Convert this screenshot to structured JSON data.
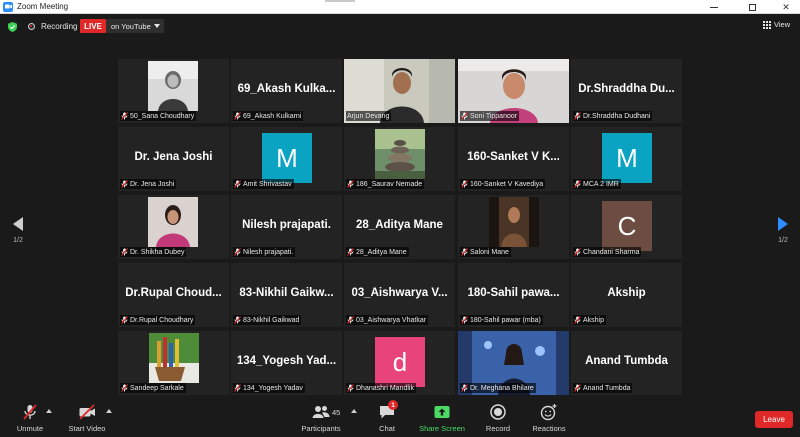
{
  "window": {
    "title": "Zoom Meeting"
  },
  "topbar": {
    "recording_label": "Recording",
    "live_label": "LIVE",
    "stream_target": "on YouTube",
    "view_label": "View"
  },
  "pagination": {
    "left": "1/2",
    "right": "1/2"
  },
  "tiles": [
    {
      "bigname": "",
      "label": "50_Sana Choudhary"
    },
    {
      "bigname": "69_Akash Kulka...",
      "label": "69_Akash Kulkarni"
    },
    {
      "bigname": "",
      "label": "Arjun Devang"
    },
    {
      "bigname": "",
      "label": "Soni Tippanoor"
    },
    {
      "bigname": "Dr.Shraddha Du...",
      "label": "Dr.Shraddha Dudhani"
    },
    {
      "bigname": "Dr. Jena Joshi",
      "label": "Dr. Jena Joshi"
    },
    {
      "bigname": "",
      "avatar": "M",
      "label": "Amit Shrivastav"
    },
    {
      "bigname": "",
      "label": "186_Saurav Nemade"
    },
    {
      "bigname": "160-Sanket V K...",
      "label": "160-Sanket V Kavediya"
    },
    {
      "bigname": "",
      "avatar": "M",
      "label": "MCA 2 IMR"
    },
    {
      "bigname": "",
      "label": "Dr. Shikha Dubey"
    },
    {
      "bigname": "Nilesh prajapati.",
      "label": "Nilesh prajapati."
    },
    {
      "bigname": "28_Aditya Mane",
      "label": "28_Aditya Mane"
    },
    {
      "bigname": "",
      "label": "Saloni Mane"
    },
    {
      "bigname": "",
      "avatar": "C",
      "label": "Chandani Sharma"
    },
    {
      "bigname": "Dr.Rupal Choud...",
      "label": "Dr.Rupal Choudhary"
    },
    {
      "bigname": "83-Nikhil Gaikw...",
      "label": "83-Nikhil Gaikwad"
    },
    {
      "bigname": "03_Aishwarya V...",
      "label": "03_Aishwarya Vhatkar"
    },
    {
      "bigname": "180-Sahil pawa...",
      "label": "180-Sahil pawar (mba)"
    },
    {
      "bigname": "Akship",
      "label": "Akship"
    },
    {
      "bigname": "",
      "label": "Sandeep Sarkale"
    },
    {
      "bigname": "134_Yogesh Yad...",
      "label": "134_Yogesh Yadav"
    },
    {
      "bigname": "",
      "avatar": "d",
      "label": "Dhanashri Mandlik"
    },
    {
      "bigname": "",
      "label": "Dr. Meghana Bhilare"
    },
    {
      "bigname": "Anand Tumbda",
      "label": "Anand Tumbda"
    }
  ],
  "toolbar": {
    "unmute": "Unmute",
    "start_video": "Start Video",
    "participants": "Participants",
    "participants_count": "45",
    "chat": "Chat",
    "chat_badge": "1",
    "share_screen": "Share Screen",
    "record": "Record",
    "reactions": "Reactions",
    "leave": "Leave"
  },
  "colors": {
    "background": "#1a1a1a",
    "tile": "#232323",
    "live_red": "#e02828",
    "active_speaker": "#b9e04e",
    "share_green": "#4cd964",
    "zoom_blue": "#2d8cff",
    "avatar_teal": "#0aa3c2",
    "avatar_brown": "#6d4c41",
    "avatar_pink": "#e8437a"
  }
}
